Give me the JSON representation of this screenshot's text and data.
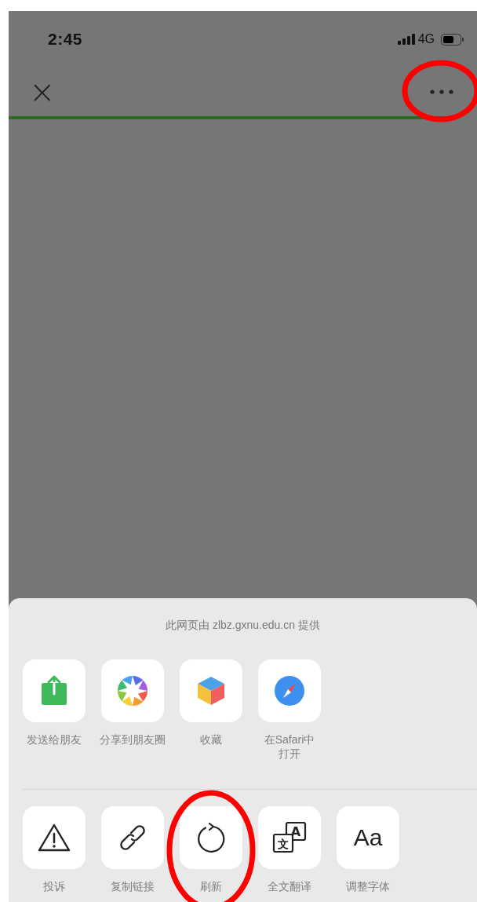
{
  "status_bar": {
    "time": "2:45",
    "network": "4G"
  },
  "nav_bar": {
    "close": {
      "glyph": "×"
    },
    "more": {
      "circled": true
    }
  },
  "page_load": {
    "level": 0.93
  },
  "sheet": {
    "caption": "此网页由 zlbz.gxnu.edu.cn 提供",
    "rows": [
      [
        {
          "kind": "share",
          "label": "发送给朋友",
          "circled": false
        },
        {
          "kind": "moments",
          "label": "分享到朋友圈",
          "circled": false
        },
        {
          "kind": "favorite",
          "label": "收藏",
          "circled": false
        },
        {
          "kind": "safari",
          "label": "在Safari中打开",
          "circled": false
        }
      ],
      [
        {
          "kind": "report",
          "label": "投诉",
          "circled": false
        },
        {
          "kind": "link",
          "label": "复制链接",
          "circled": false
        },
        {
          "kind": "refresh",
          "label": "刷新",
          "circled": true
        },
        {
          "kind": "translate",
          "label": "全文翻译",
          "glyphs": [
            "A",
            "文"
          ],
          "circled": false
        },
        {
          "kind": "font",
          "label": "调整字体",
          "glyph": "Aa",
          "circled": false
        }
      ]
    ]
  }
}
